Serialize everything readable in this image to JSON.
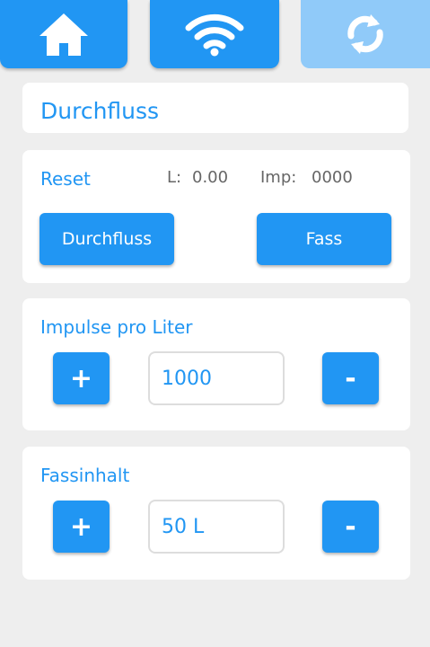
{
  "nav": {
    "home_icon": "home-icon",
    "wifi_icon": "wifi-icon",
    "sync_icon": "sync-icon",
    "colors": {
      "active": "#2196f3",
      "disabled": "#90caf9"
    }
  },
  "title_card": {
    "title": "Durchfluss"
  },
  "reset_card": {
    "label": "Reset",
    "liters_label": "L:",
    "liters_value": "0.00",
    "impulses_label": "Imp:",
    "impulses_value": "0000",
    "durchfluss_button": "Durchfluss",
    "fass_button": "Fass"
  },
  "impulse_card": {
    "label": "Impulse pro Liter",
    "plus": "+",
    "minus": "-",
    "value": "1000"
  },
  "capacity_card": {
    "label": "Fassinhalt",
    "plus": "+",
    "minus": "-",
    "value": "50 L"
  }
}
